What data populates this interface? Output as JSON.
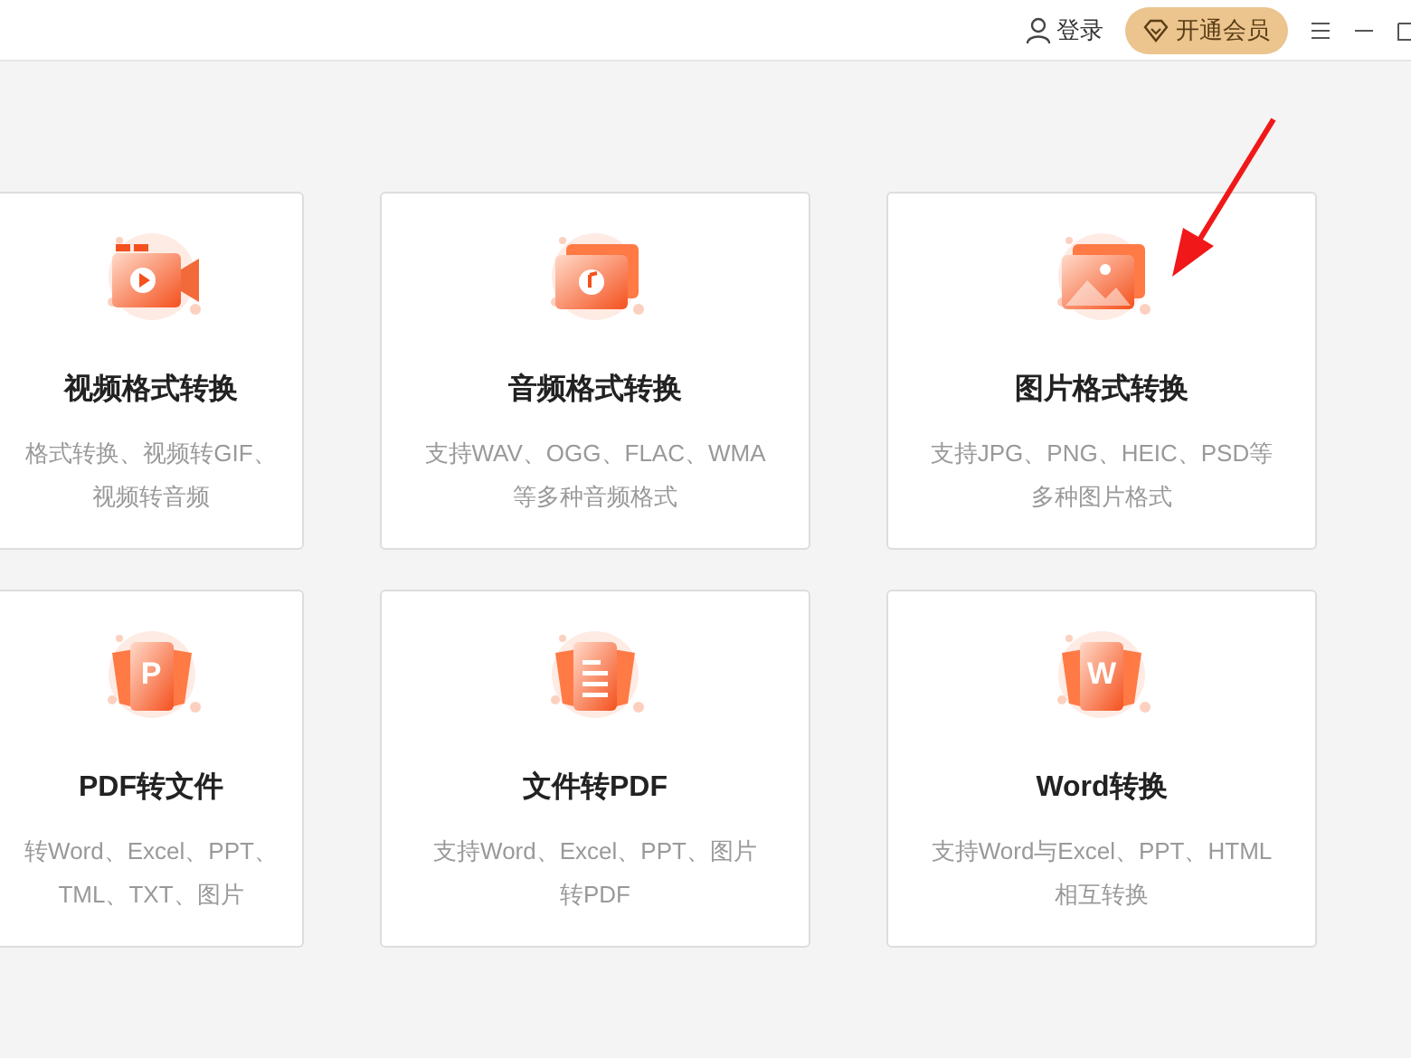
{
  "header": {
    "login": "登录",
    "vip": "开通会员"
  },
  "cards": [
    {
      "kind": "video",
      "title": "视频格式转换",
      "desc": [
        "格式转换、视频转GIF、",
        "视频转音频"
      ]
    },
    {
      "kind": "audio",
      "title": "音频格式转换",
      "desc": [
        "支持WAV、OGG、FLAC、WMA",
        "等多种音频格式"
      ]
    },
    {
      "kind": "image",
      "title": "图片格式转换",
      "desc": [
        "支持JPG、PNG、HEIC、PSD等",
        "多种图片格式"
      ]
    },
    {
      "kind": "doc",
      "letter": "P",
      "title": "PDF转文件",
      "desc": [
        "转Word、Excel、PPT、",
        "TML、TXT、图片"
      ]
    },
    {
      "kind": "lines",
      "title": "文件转PDF",
      "desc": [
        "支持Word、Excel、PPT、图片",
        "转PDF"
      ]
    },
    {
      "kind": "doc",
      "letter": "W",
      "title": "Word转换",
      "desc": [
        "支持Word与Excel、PPT、HTML",
        "相互转换"
      ]
    }
  ]
}
